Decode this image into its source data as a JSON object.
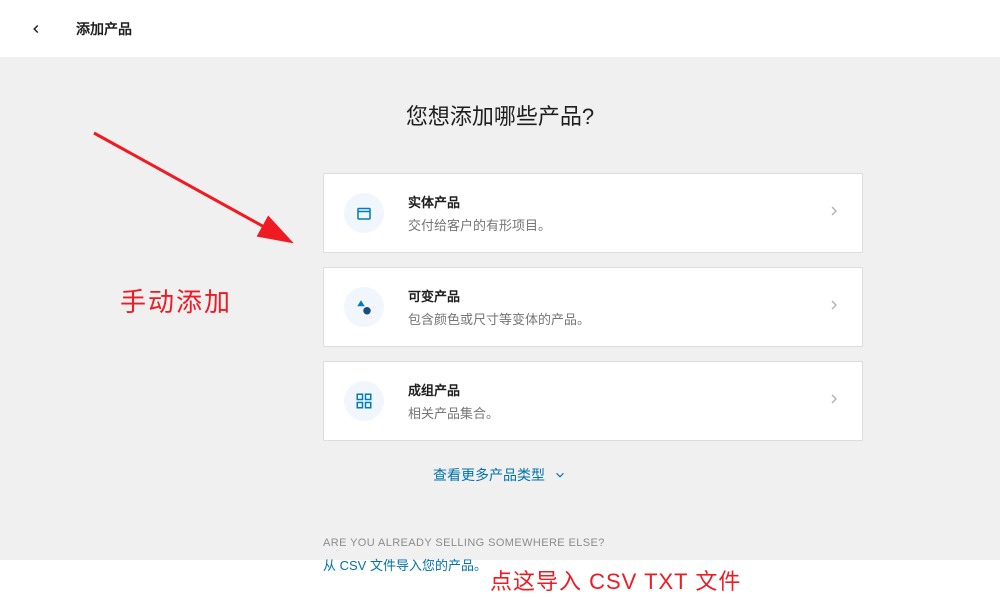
{
  "header": {
    "title": "添加产品"
  },
  "main": {
    "heading": "您想添加哪些产品?"
  },
  "cards": [
    {
      "title": "实体产品",
      "desc": "交付给客户的有形项目。"
    },
    {
      "title": "可变产品",
      "desc": "包含颜色或尺寸等变体的产品。"
    },
    {
      "title": "成组产品",
      "desc": "相关产品集合。"
    }
  ],
  "more": {
    "label": "查看更多产品类型"
  },
  "selling": {
    "caption": "ARE YOU ALREADY SELLING SOMEWHERE ELSE?",
    "csv_link": "从 CSV 文件导入您的产品。"
  },
  "annotations": {
    "manual_add": "手动添加",
    "csv_note": "点这导入 CSV TXT 文件"
  }
}
